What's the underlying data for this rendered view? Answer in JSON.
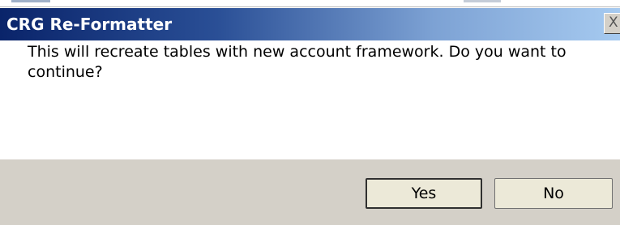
{
  "window": {
    "title": "CRG Re-Formatter",
    "close_glyph": "X",
    "close_icon": "close-icon"
  },
  "dialog": {
    "message": "This will recreate tables with new account framework.  Do you want to continue?"
  },
  "buttons": {
    "yes_label": "Yes",
    "no_label": "No"
  },
  "colors": {
    "title_bar_start": "#0a246a",
    "title_bar_end": "#a6caf0",
    "button_bar": "#d4d0c8"
  }
}
